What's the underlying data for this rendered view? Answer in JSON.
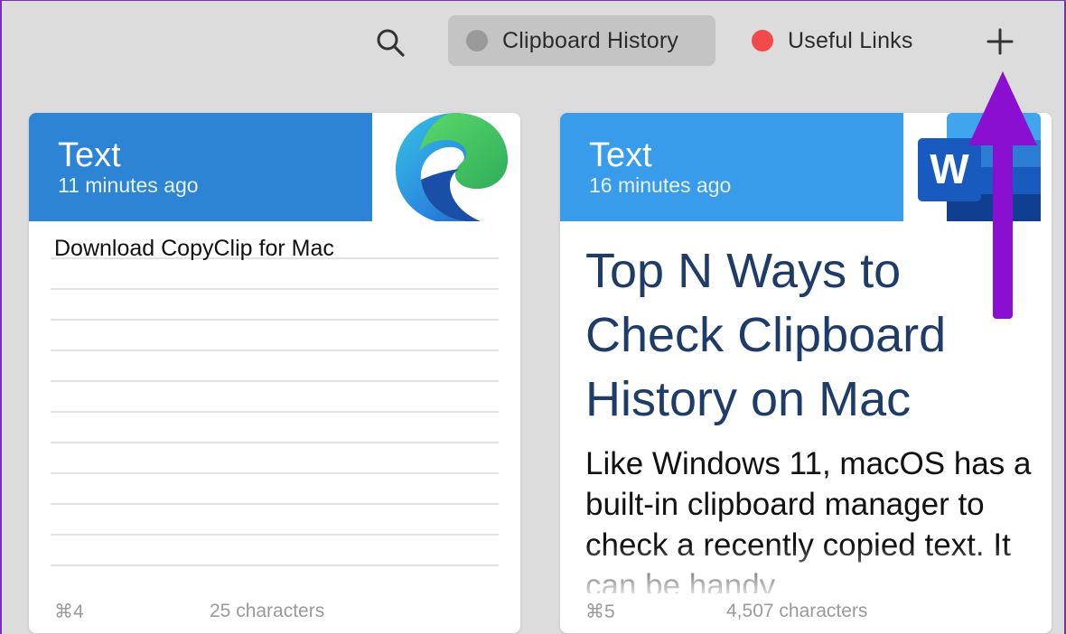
{
  "toolbar": {
    "search_icon": "search-icon",
    "tabs": [
      {
        "label": "Clipboard History",
        "dot_color": "#9a9a9a",
        "active": true
      },
      {
        "label": "Useful Links",
        "dot_color": "#f04a4a",
        "active": false
      }
    ],
    "add_icon": "plus-icon"
  },
  "cards": [
    {
      "type": "Text",
      "time": "11 minutes ago",
      "app_icon": "edge-icon",
      "content": "Download CopyClip for Mac",
      "shortcut": "⌘4",
      "char_count": "25 characters",
      "header_color": "#2d83d4"
    },
    {
      "type": "Text",
      "time": "16 minutes ago",
      "app_icon": "word-icon",
      "heading": "Top N Ways to Check Clipboard History on Mac",
      "body": "Like Windows 11, macOS has a built-in clipboard manager to check a recently copied text. It can be handy",
      "shortcut": "⌘5",
      "char_count": "4,507 characters",
      "header_color": "#399cea"
    }
  ],
  "annotation": {
    "arrow_color": "#8a0fd0",
    "arrow_icon": "arrow-up-icon"
  }
}
